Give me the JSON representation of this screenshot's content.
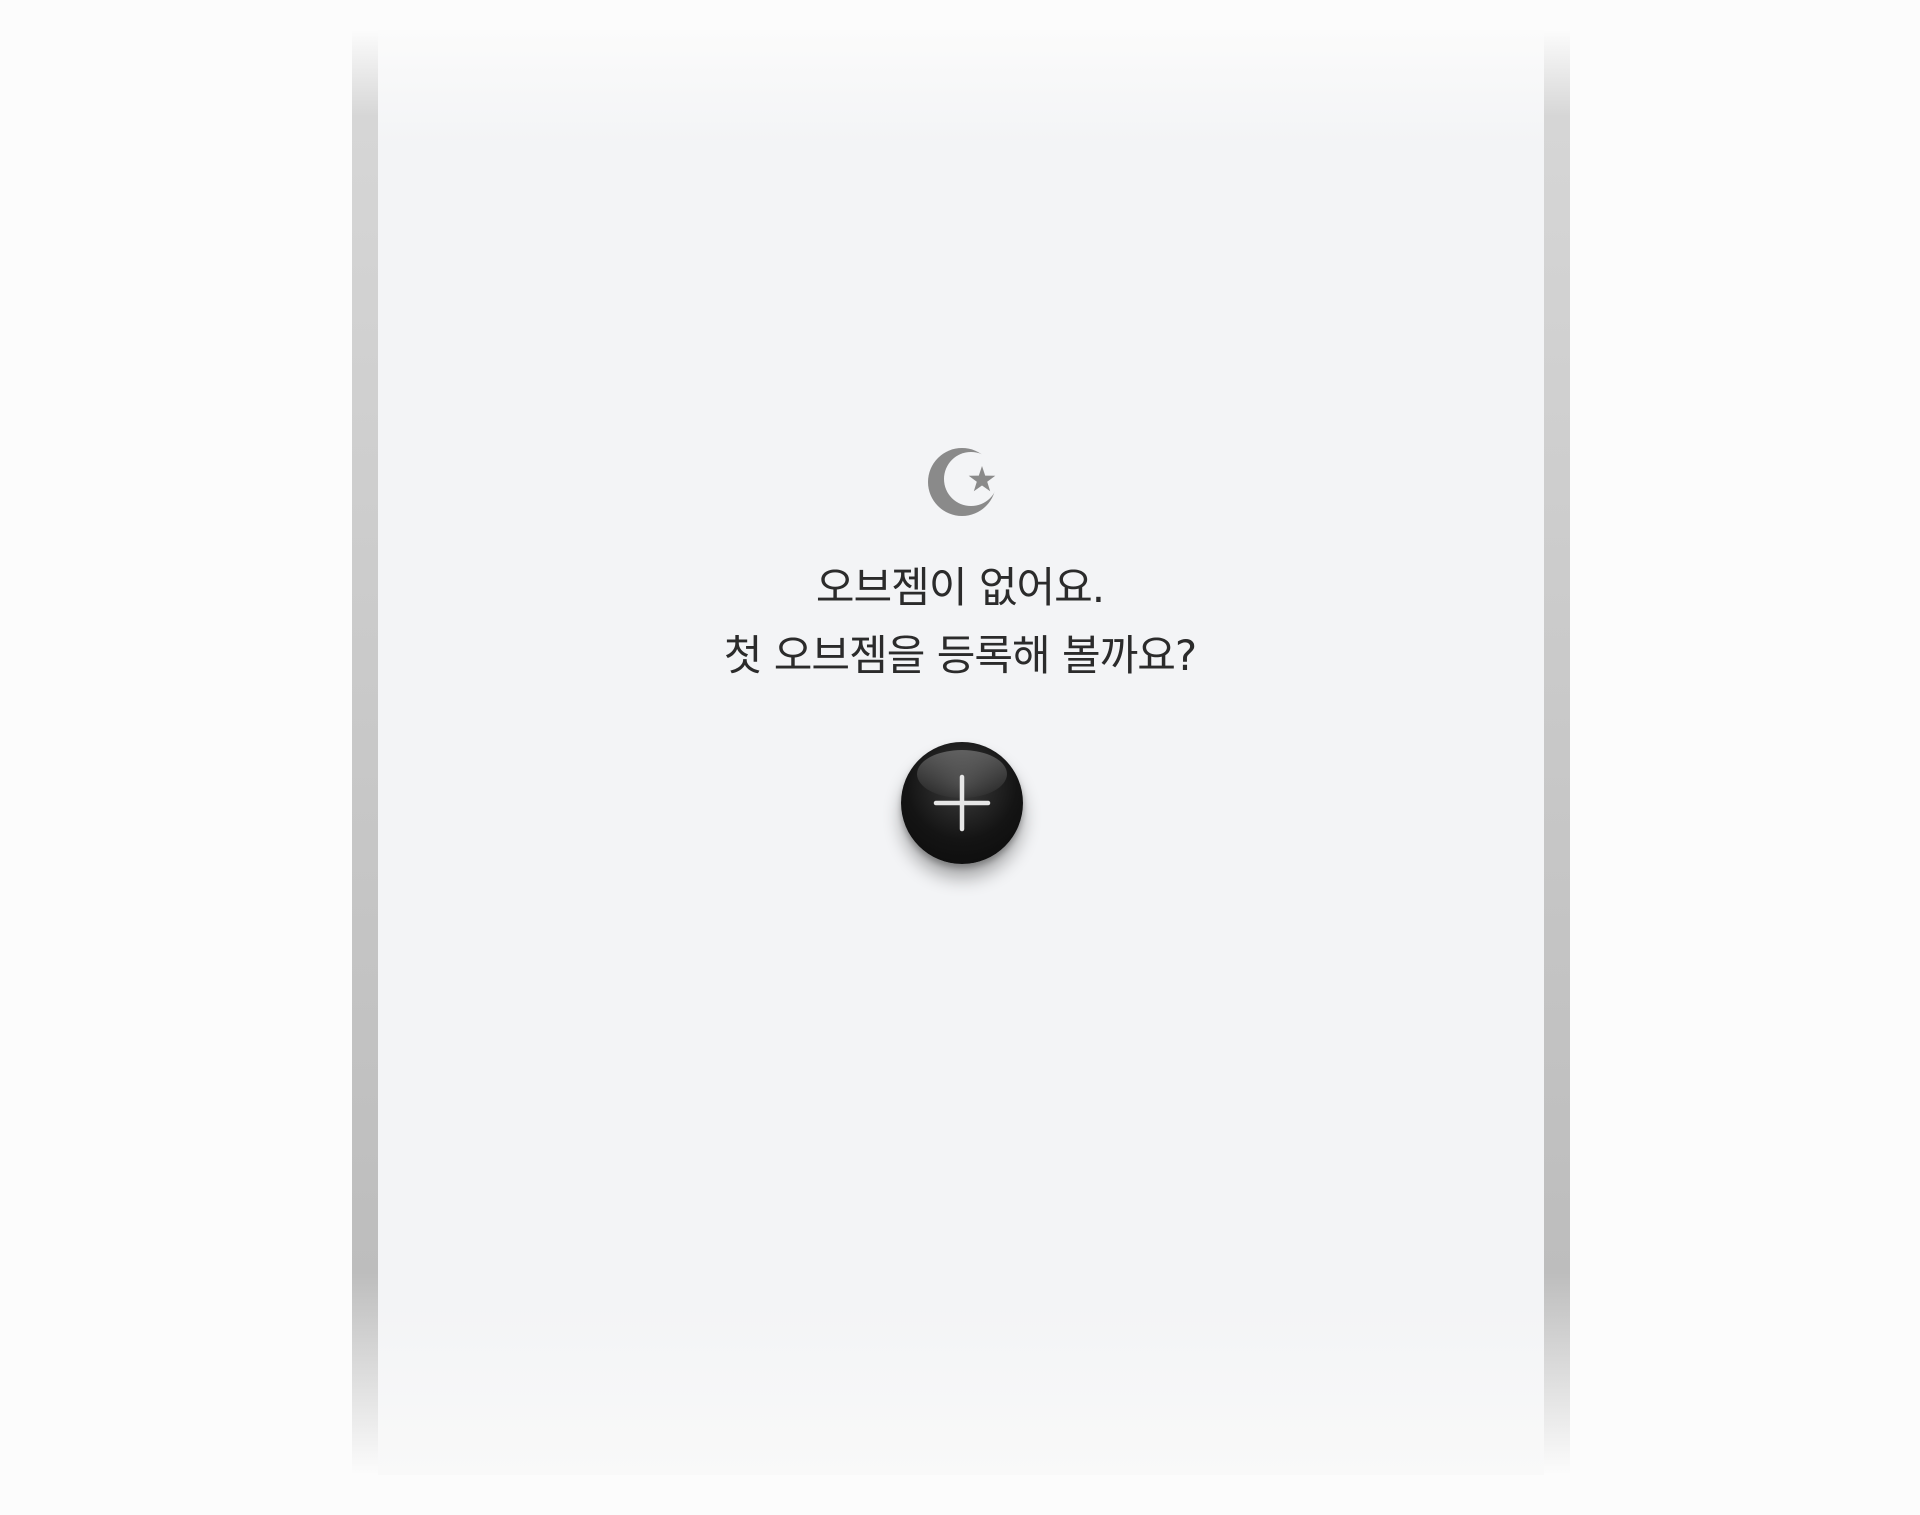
{
  "empty_state": {
    "icon": "crescent-moon-star-icon",
    "message_line1": "오브젬이 없어요.",
    "message_line2": "첫 오브젬을 등록해 볼까요?",
    "add_button_icon": "plus-icon"
  },
  "colors": {
    "panel_background": "#f3f4f6",
    "text": "#2b2b2b",
    "icon_gray": "#8a8a8a",
    "button_dark": "#141414"
  }
}
